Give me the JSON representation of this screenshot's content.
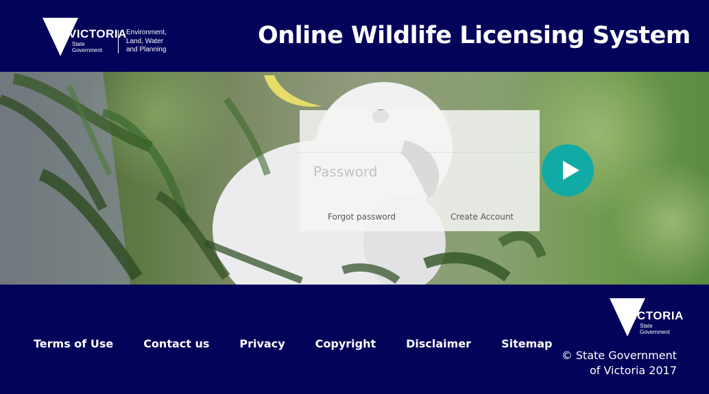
{
  "header": {
    "logo_wordmark": "VICTORIA",
    "logo_sub": "State\nGovernment",
    "department": "Environment,\nLand, Water\nand Planning",
    "title": "Online Wildlife Licensing System"
  },
  "login": {
    "password_placeholder": "Password",
    "forgot_label": "Forgot password",
    "create_label": "Create Account",
    "submit_icon": "play-arrow-icon"
  },
  "footer": {
    "links": [
      "Terms of Use",
      "Contact us",
      "Privacy",
      "Copyright",
      "Disclaimer",
      "Sitemap"
    ],
    "logo_wordmark": "VICTORIA",
    "logo_sub": "State\nGovernment",
    "copyright": "© State Government\nof Victoria 2017"
  },
  "colors": {
    "navy": "#03035a",
    "teal": "#12aaa4",
    "login_panel": "#f5f5f3"
  }
}
